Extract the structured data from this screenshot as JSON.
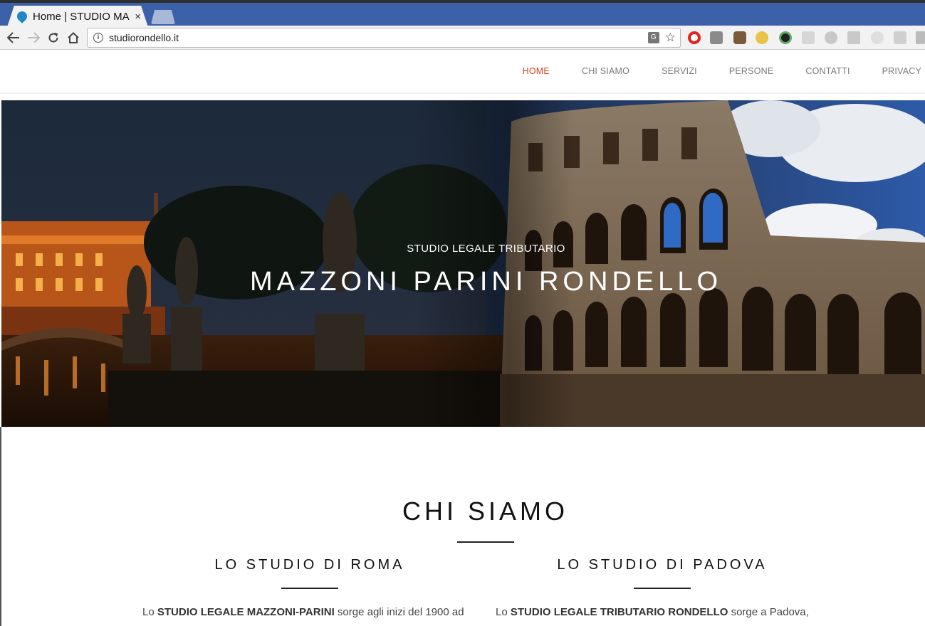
{
  "browser": {
    "tab_title": "Home | STUDIO MA",
    "tab_close": "×",
    "url": "studiorondello.it",
    "back_icon": "arrow-left-icon",
    "forward_icon": "arrow-right-icon",
    "reload_icon": "reload-icon",
    "home_icon": "home-icon",
    "extensions": [
      "opera-icon",
      "extension-icon",
      "instagram-icon",
      "extension-icon",
      "camera-icon",
      "dropbox-icon",
      "extension-icon",
      "bookmark-icon",
      "extension-icon",
      "rss-icon",
      "extension-icon"
    ]
  },
  "site": {
    "menu": [
      "HOME",
      "CHI SIAMO",
      "SERVIZI",
      "PERSONE",
      "CONTATTI",
      "PRIVACY"
    ],
    "active_color": "#d2451e"
  },
  "hero": {
    "subtitle": "STUDIO LEGALE TRIBUTARIO",
    "title": "MAZZONI PARINI RONDELLO"
  },
  "about": {
    "title": "CHI SIAMO",
    "roma": {
      "title": "LO STUDIO DI ROMA",
      "text_prefix": "Lo ",
      "text_bold": "STUDIO LEGALE MAZZONI-PARINI",
      "text_suffix": " sorge agli inizi del 1900 ad"
    },
    "padova": {
      "title": "LO STUDIO DI PADOVA",
      "text_prefix": "Lo ",
      "text_bold": "STUDIO LEGALE TRIBUTARIO RONDELLO",
      "text_suffix": " sorge a Padova,"
    }
  }
}
